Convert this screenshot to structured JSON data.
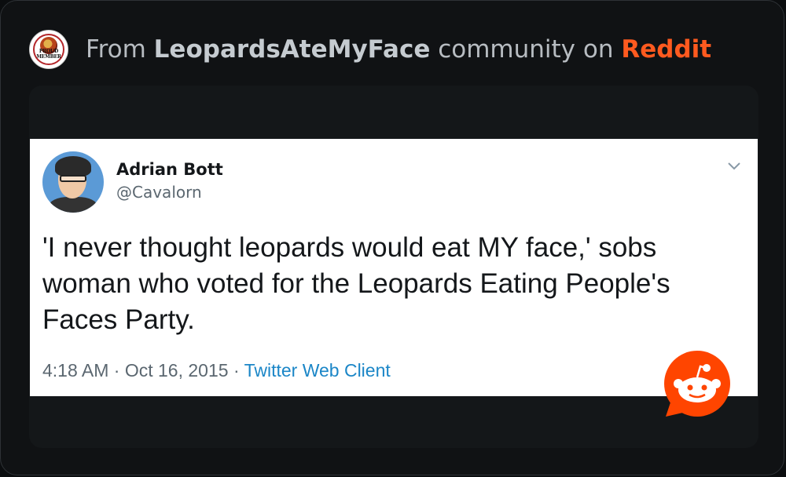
{
  "header": {
    "prefix": "From",
    "community": "LeopardsAteMyFace",
    "middle": "community on",
    "site": "Reddit",
    "logo_text": "PROUD MEMBER"
  },
  "tweet": {
    "author_name": "Adrian Bott",
    "handle": "@Cavalorn",
    "text": "'I never thought leopards would eat MY face,' sobs woman who voted for the Leopards Eating People's Faces Party.",
    "time": "4:18 AM",
    "date": "Oct 16, 2015",
    "client": "Twitter Web Client"
  },
  "icons": [
    "community-logo-icon",
    "avatar",
    "chevron-down-icon",
    "reddit-snoo-icon"
  ],
  "colors": {
    "reddit_orange": "#ff5a1f",
    "twitter_link": "#1b86c7",
    "background": "#101214"
  }
}
